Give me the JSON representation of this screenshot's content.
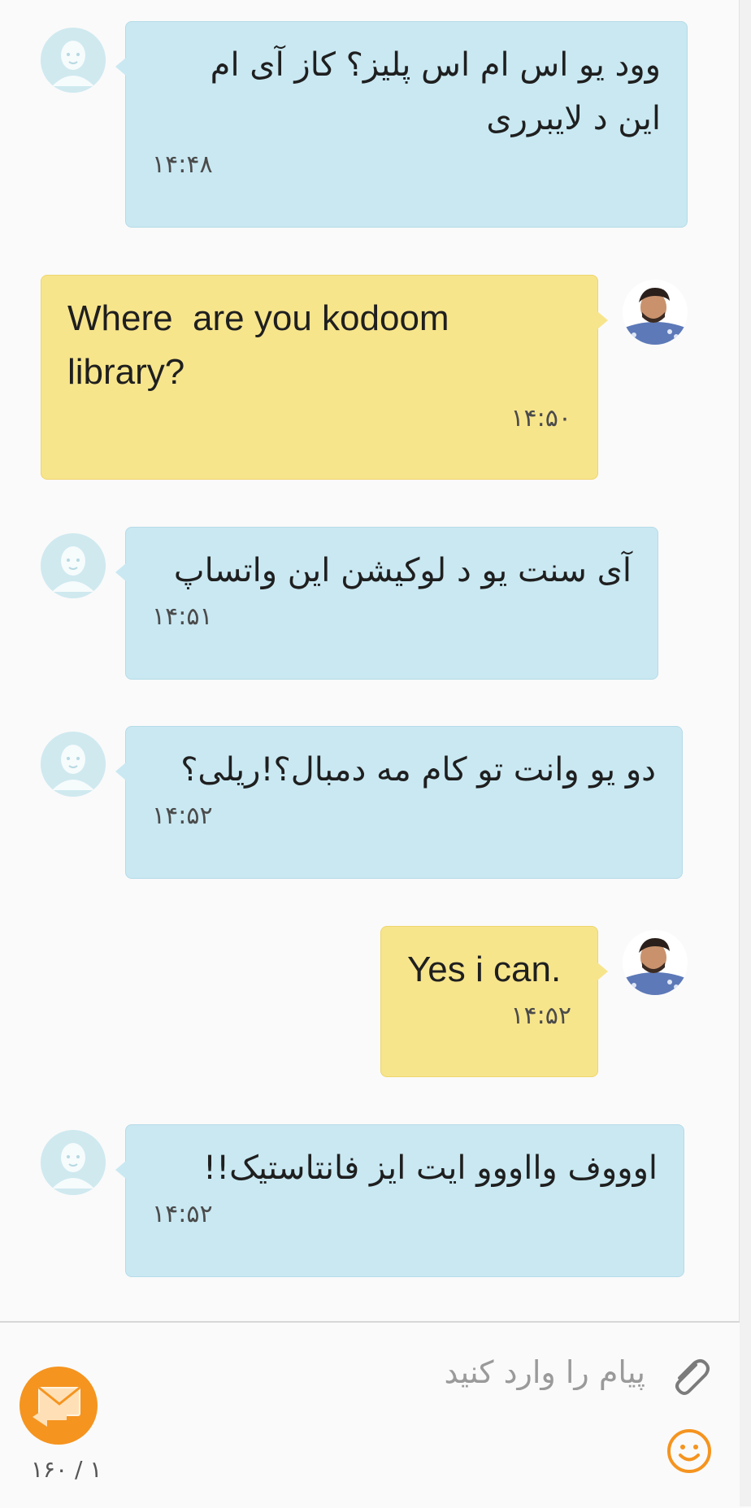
{
  "conversation": {
    "messages": [
      {
        "direction": "incoming",
        "text": "وود یو اس ام اس پلیز؟ کاز آی ام\nاین د لایبرری",
        "time": "۱۴:۴۸"
      },
      {
        "direction": "outgoing",
        "text": "Where  are you kodoom\nlibrary?",
        "time": "۱۴:۵۰"
      },
      {
        "direction": "incoming",
        "text": "آی سنت یو د لوکیشن این واتساپ",
        "time": "۱۴:۵۱"
      },
      {
        "direction": "incoming",
        "text": "دو یو وانت تو کام مه دمبال؟!ریلی؟",
        "time": "۱۴:۵۲"
      },
      {
        "direction": "outgoing",
        "text": "Yes i can.",
        "time": "۱۴:۵۲"
      },
      {
        "direction": "incoming",
        "text": "اوووف وااووو ایت ایز فانتاستیک!!",
        "time": "۱۴:۵۲"
      }
    ]
  },
  "composer": {
    "placeholder": "پیام را وارد کنید",
    "value": "",
    "counter": "۱ / ۱۶۰",
    "send_icon": "send-message-icon",
    "attach_icon": "paperclip-icon",
    "emoji_icon": "smiley-face-icon"
  },
  "colors": {
    "incoming_bubble": "#c9e8f2",
    "outgoing_bubble": "#f7e58c",
    "send_button": "#f5941f",
    "emoji_icon": "#f5941f",
    "contact_avatar": "#cfe9ef"
  }
}
